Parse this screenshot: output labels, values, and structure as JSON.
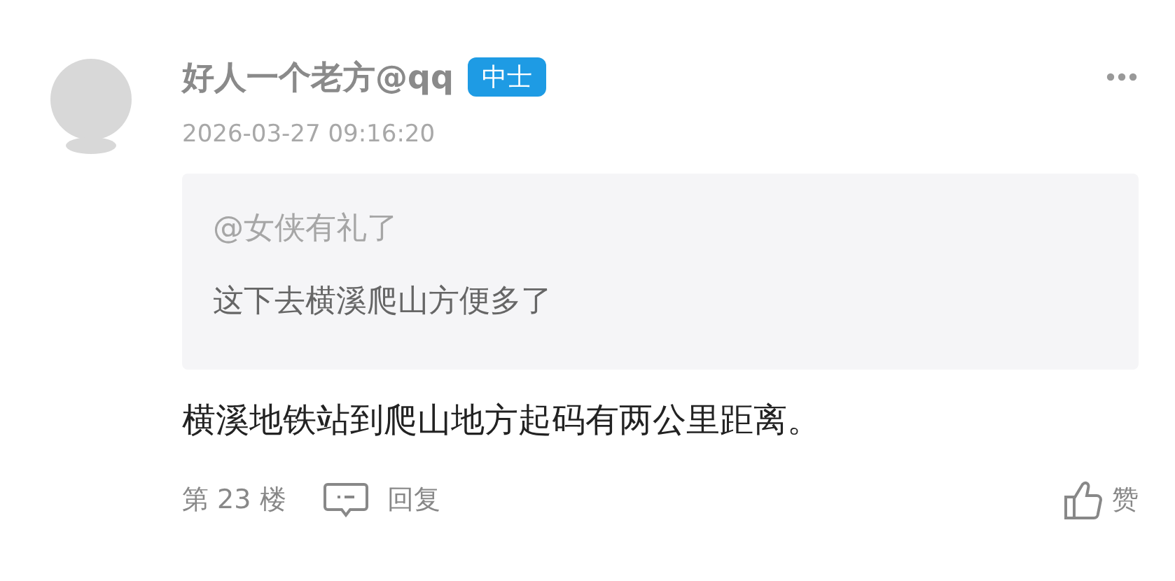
{
  "post": {
    "author": "好人一个老方@qq",
    "rank_badge": "中士",
    "timestamp": "2026-03-27 09:16:20",
    "quote": {
      "mention": "@女侠有礼了",
      "text": "这下去横溪爬山方便多了"
    },
    "body": "横溪地铁站到爬山地方起码有两公里距离。",
    "floor": "第 23 楼",
    "reply_label": "回复",
    "like_label": "赞"
  }
}
